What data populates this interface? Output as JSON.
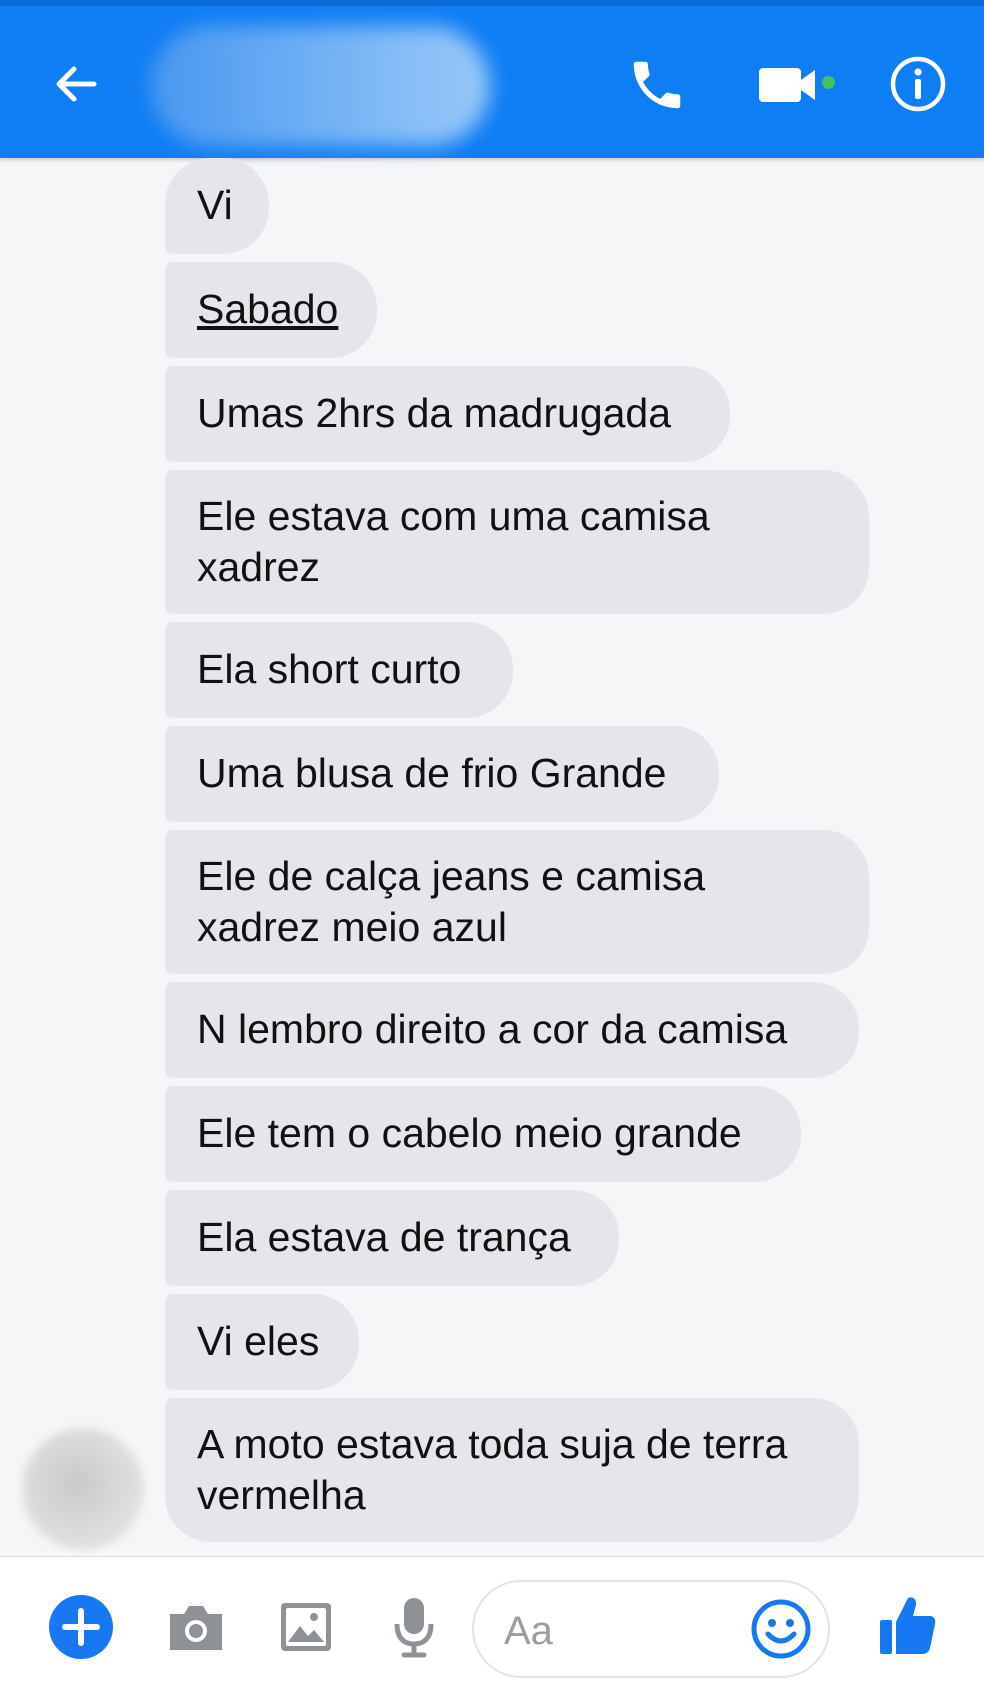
{
  "header": {
    "back_icon": "arrow-left-icon",
    "contact_name": "",
    "call_icon": "phone-icon",
    "video_icon": "video-camera-icon",
    "online_status_color": "#44c15e",
    "info_icon": "info-icon",
    "color": "#0f7df4"
  },
  "messages": [
    {
      "text": "Vi"
    },
    {
      "text": "Sabado"
    },
    {
      "text": "Umas 2hrs da madrugada"
    },
    {
      "line1": "Ele estava com uma camisa",
      "line2": "xadrez"
    },
    {
      "text": "Ela short curto"
    },
    {
      "text": "Uma blusa de frio Grande"
    },
    {
      "line1": "Ele de calça jeans e camisa",
      "line2": "xadrez meio azul"
    },
    {
      "text": "N lembro direito a cor da camisa"
    },
    {
      "text": "Ele tem o cabelo meio grande"
    },
    {
      "text": "Ela estava de trança"
    },
    {
      "text": "Vi eles"
    },
    {
      "line1": "A moto estava toda suja de terra",
      "line2": "vermelha"
    }
  ],
  "composer": {
    "placeholder": "Aa",
    "add_icon": "plus-circle-icon",
    "camera_icon": "camera-icon",
    "gallery_icon": "image-icon",
    "mic_icon": "microphone-icon",
    "emoji_icon": "smiley-icon",
    "like_icon": "thumbs-up-icon",
    "accent_color": "#1877f2"
  }
}
